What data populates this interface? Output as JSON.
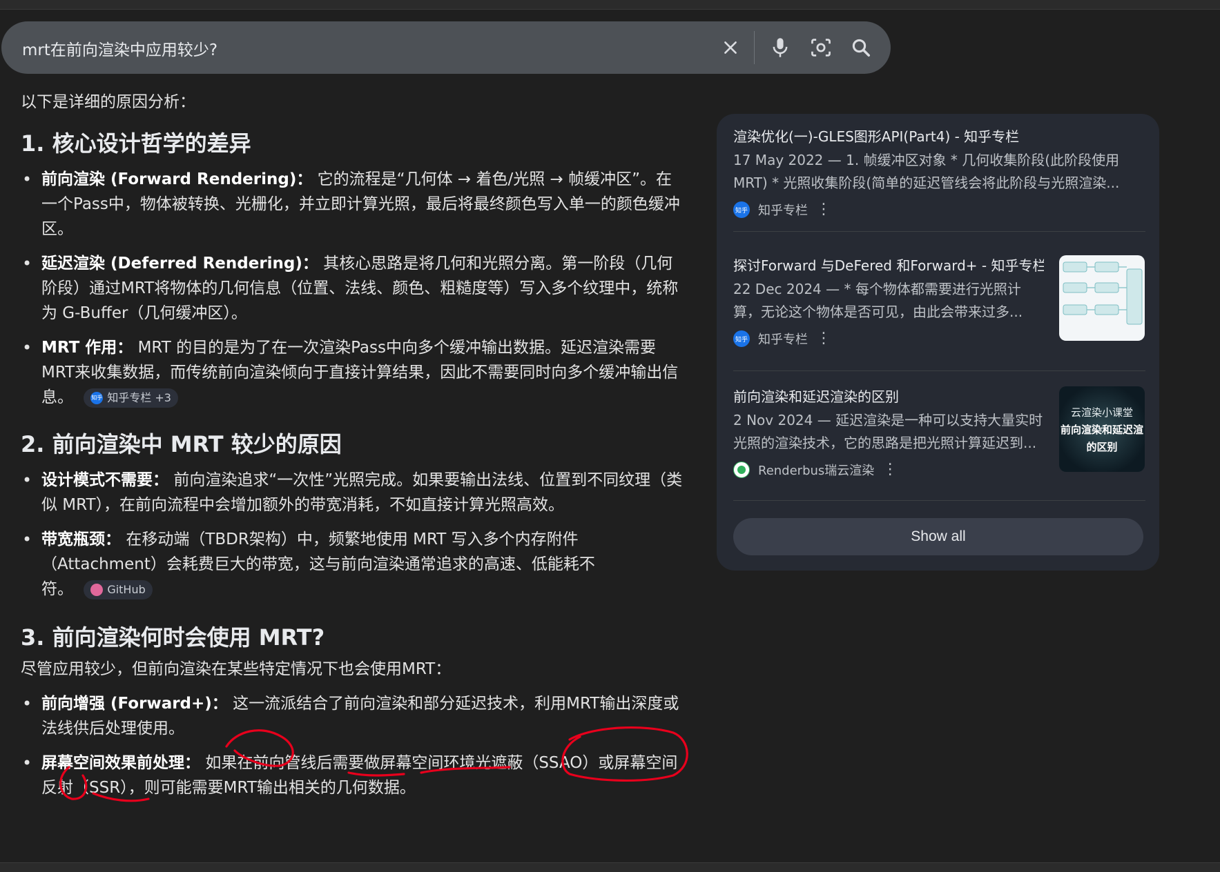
{
  "search": {
    "query": "mrt在前向渲染中应用较少?"
  },
  "answer": {
    "intro": "以下是详细的原因分析：",
    "sections": [
      {
        "heading": "1. 核心设计哲学的差异",
        "items": [
          {
            "lead": "前向渲染 (Forward Rendering)：",
            "text": "它的流程是“几何体 → 着色/光照 → 帧缓冲区”。在一个Pass中，物体被转换、光栅化，并立即计算光照，最后将最终颜色写入单一的颜色缓冲区。"
          },
          {
            "lead": "延迟渲染 (Deferred Rendering)：",
            "text": "其核心思路是将几何和光照分离。第一阶段（几何阶段）通过MRT将物体的几何信息（位置、法线、颜色、粗糙度等）写入多个纹理中，统称为 G-Buffer（几何缓冲区）。"
          },
          {
            "lead": "MRT 作用：",
            "text": "MRT 的目的是为了在一次渲染Pass中向多个缓冲输出数据。延迟渲染需要MRT来收集数据，而传统前向渲染倾向于直接计算结果，因此不需要同时向多个缓冲输出信息。",
            "chip": "知乎专栏 +3",
            "chip_icon": "知乎"
          }
        ]
      },
      {
        "heading": "2. 前向渲染中 MRT 较少的原因",
        "items": [
          {
            "lead": "设计模式不需要：",
            "text": "前向渲染追求“一次性”光照完成。如果要输出法线、位置到不同纹理（类似 MRT），在前向流程中会增加额外的带宽消耗，不如直接计算光照高效。"
          },
          {
            "lead": "带宽瓶颈：",
            "text": "在移动端（TBDR架构）中，频繁地使用 MRT 写入多个内存附件（Attachment）会耗费巨大的带宽，这与前向渲染通常追求的高速、低能耗不符。",
            "chip": "GitHub"
          }
        ]
      },
      {
        "heading": "3. 前向渲染何时会使用 MRT?",
        "intro": "尽管应用较少，但前向渲染在某些特定情况下也会使用MRT：",
        "items": [
          {
            "lead": "前向增强 (Forward+)：",
            "text": "这一流派结合了前向渲染和部分延迟技术，利用MRT输出深度或法线供后处理使用。"
          },
          {
            "lead": "屏幕空间效果前处理：",
            "text": "如果在前向管线后需要做屏幕空间环境光遮蔽（SSAO）或屏幕空间反射（SSR），则可能需要MRT输出相关的几何数据。"
          }
        ]
      }
    ]
  },
  "sources": [
    {
      "title": "渲染优化(一)-GLES图形API(Part4) - 知乎专栏",
      "snippet": "17 May 2022 — 1. 帧缓冲区对象 * 几何收集阶段(此阶段使用MRT) * 光照收集阶段(简单的延迟管线会将此阶段与光照渲染...",
      "site": "知乎专栏",
      "favicon_text": "知乎"
    },
    {
      "title": "探讨Forward 与DeFered 和Forward+ - 知乎专栏",
      "snippet": "22 Dec 2024 — * 每个物体都需要进行光照计算，无论这个物体是否可见，由此会带来过多...",
      "site": "知乎专栏",
      "favicon_text": "知乎"
    },
    {
      "title": "前向渲染和延迟渲染的区别",
      "snippet": "2 Nov 2024 — 延迟渲染是一种可以支持大量实时光照的渲染技术，它的思路是把光照计算延迟到...",
      "site": "Renderbus瑞云渲染",
      "thumb_text": [
        "云渲染小课堂",
        "前向渲染和延迟渲",
        "的区别"
      ]
    }
  ],
  "show_all_label": "Show all",
  "colors": {
    "background": "#1f1f1f",
    "searchbar": "#4d5156",
    "panel": "#262a33",
    "annotation": "#e8001c"
  }
}
